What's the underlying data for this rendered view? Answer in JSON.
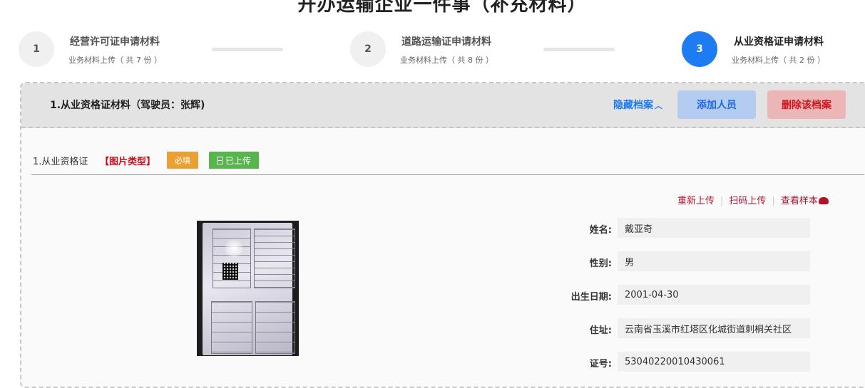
{
  "page": {
    "title": "开办运输企业一件事（补充材料）"
  },
  "steps": [
    {
      "number": "1",
      "title": "经营许可证申请材料",
      "subtitle": "业务材料上传（ 共 7 份 ）"
    },
    {
      "number": "2",
      "title": "道路运输证申请材料",
      "subtitle": "业务材料上传（ 共 8 份 ）"
    },
    {
      "number": "3",
      "title": "从业资格证申请材料",
      "subtitle": "业务材料上传（ 共 2 份 ）"
    }
  ],
  "archive": {
    "title": "1.从业资格证材料（驾驶员：张辉)",
    "hide_label": "隐藏档案",
    "add_label": "添加人员",
    "delete_label": "删除该档案"
  },
  "material": {
    "label": "1.从业资格证",
    "type": "【图片类型】",
    "required_tag": "必填",
    "uploaded_tag": "已上传"
  },
  "actions": {
    "reupload": "重新上传",
    "scan_upload": "扫码上传",
    "view_sample": "查看样本"
  },
  "fields": [
    {
      "label": "姓名:",
      "value": "戴亚奇"
    },
    {
      "label": "性别:",
      "value": "男"
    },
    {
      "label": "出生日期:",
      "value": "2001-04-30"
    },
    {
      "label": "住址:",
      "value": "云南省玉溪市红塔区化城街道刺桐关社区"
    },
    {
      "label": "证号:",
      "value": "53040220010430061"
    }
  ],
  "colors": {
    "primary": "#1e7cf2",
    "danger": "#d0121b",
    "required": "#eba033",
    "uploaded": "#58b44c"
  }
}
